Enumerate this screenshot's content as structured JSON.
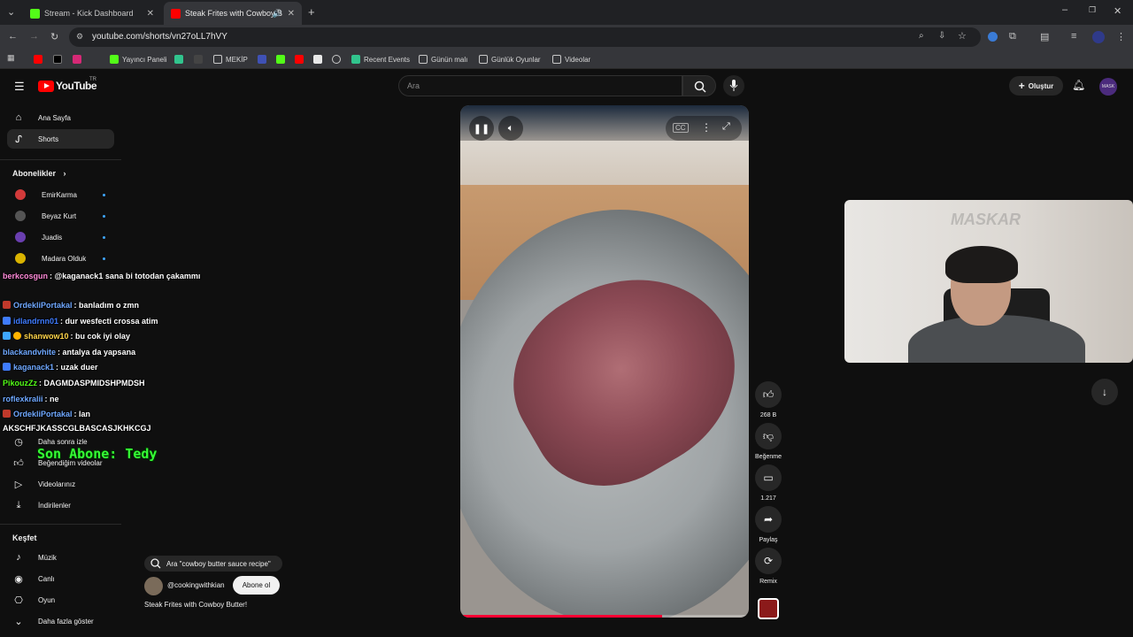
{
  "browser": {
    "tabs": [
      {
        "title": "Stream - Kick Dashboard",
        "favicon_color": "#53fc18",
        "active": false
      },
      {
        "title": "Steak Frites with Cowboy B",
        "favicon_color": "#ff0000",
        "active": true
      }
    ],
    "url": "youtube.com/shorts/vn27oLL7hVY",
    "bookmarks": [
      {
        "label": "",
        "icon": "youtube-icon",
        "color": "#ff0000"
      },
      {
        "label": "",
        "icon": "x-icon",
        "color": "#000000"
      },
      {
        "label": "",
        "icon": "instagram-icon",
        "color": "#d62976"
      },
      {
        "label": "Yayıncı Paneli",
        "icon": "kick-icon",
        "color": "#53fc18"
      },
      {
        "label": "",
        "icon": "app-icon",
        "color": "#31c48d"
      },
      {
        "label": "",
        "icon": "terminal-icon",
        "color": "#444444"
      },
      {
        "label": "MEKİP",
        "icon": "folder-icon",
        "color": "#c8c8c8"
      },
      {
        "label": "",
        "icon": "app-icon",
        "color": "#3f51b5"
      },
      {
        "label": "",
        "icon": "kick-icon",
        "color": "#53fc18"
      },
      {
        "label": "",
        "icon": "youtube-icon",
        "color": "#ff0000"
      },
      {
        "label": "",
        "icon": "image-icon",
        "color": "#e8e8e8"
      },
      {
        "label": "",
        "icon": "globe-icon",
        "color": "#c8c8c8"
      },
      {
        "label": "Recent Events",
        "icon": "app-icon",
        "color": "#31c48d"
      },
      {
        "label": "Günün malı",
        "icon": "folder-icon",
        "color": "#c8c8c8"
      },
      {
        "label": "Günlük Oyunlar",
        "icon": "folder-icon",
        "color": "#c8c8c8"
      },
      {
        "label": "Videolar",
        "icon": "folder-icon",
        "color": "#c8c8c8"
      }
    ]
  },
  "youtube": {
    "logo_text": "YouTube",
    "country": "TR",
    "search_placeholder": "Ara",
    "create_label": "Oluştur",
    "avatar_text": "MASK",
    "sidebar": {
      "main": [
        {
          "label": "Ana Sayfa",
          "icon": "home-icon"
        },
        {
          "label": "Shorts",
          "icon": "shorts-icon",
          "active": true
        }
      ],
      "subscriptions_title": "Abonelikler",
      "subscriptions": [
        {
          "label": "EmirKarma",
          "color": "#d23a3a"
        },
        {
          "label": "Beyaz Kurt",
          "color": "#555555"
        },
        {
          "label": "Juadis",
          "color": "#6a3fb0"
        },
        {
          "label": "Madara Olduk",
          "color": "#d9b300"
        }
      ],
      "you_items": [
        {
          "label": "Daha sonra izle",
          "icon": "clock-icon"
        },
        {
          "label": "Beğendiğim videolar",
          "icon": "thumb-up-icon"
        },
        {
          "label": "Videolarınız",
          "icon": "play-icon"
        },
        {
          "label": "İndirilenler",
          "icon": "download-icon"
        }
      ],
      "explore_title": "Keşfet",
      "explore": [
        {
          "label": "Müzik",
          "icon": "music-icon"
        },
        {
          "label": "Canlı",
          "icon": "live-icon"
        },
        {
          "label": "Oyun",
          "icon": "game-icon"
        },
        {
          "label": "Daha fazla göster",
          "icon": "chevron-down-icon"
        }
      ]
    },
    "short": {
      "suggested_search": "Ara \"cowboy butter sauce recipe\"",
      "channel": "@cookingwithkian",
      "subscribe_label": "Abone ol",
      "title": "Steak Frites with Cowboy Butter!",
      "progress": 0.7,
      "actions": [
        {
          "label": "268 B",
          "icon": "thumb-up-icon"
        },
        {
          "label": "Beğenme",
          "icon": "thumb-down-icon"
        },
        {
          "label": "1.217",
          "icon": "comment-icon"
        },
        {
          "label": "Paylaş",
          "icon": "share-icon"
        },
        {
          "label": "Remix",
          "icon": "remix-icon"
        }
      ]
    }
  },
  "chat": [
    {
      "user": "berkcosgun",
      "color": "#ff8ad8",
      "message": ": @kaganack1 sana bi totodan çakammı"
    },
    {
      "user": "OrdekliPortakal",
      "color": "#6fa8ff",
      "message": ": banladım o zmn"
    },
    {
      "user": "idlandrnn01",
      "color": "#3f7cff",
      "message": ": dur wesfecti crossa atim"
    },
    {
      "user": "shanwow10",
      "color": "#ffd54a",
      "message": ": bu cok iyi olay"
    },
    {
      "user": "blackandvhite",
      "color": "#6fa8ff",
      "message": ": antalya da yapsana"
    },
    {
      "user": "kaganack1",
      "color": "#6fa8ff",
      "message": ": uzak duer"
    },
    {
      "user": "PikouzZz",
      "color": "#53fc18",
      "message": ": DAGMDASPMIDSHPMDSH"
    },
    {
      "user": "roflexkralii",
      "color": "#6fa8ff",
      "message": ": ne"
    },
    {
      "user": "OrdekliPortakal",
      "color": "#6fa8ff",
      "message": ": lan"
    },
    {
      "user": "",
      "color": "#ffffff",
      "message": "AKSCHFJKASSCGLBASCASJKHKCGJ"
    }
  ],
  "overlay": {
    "last_sub": "Son Abone: Tedy"
  },
  "webcam": {
    "watermark": "MASKAR"
  }
}
